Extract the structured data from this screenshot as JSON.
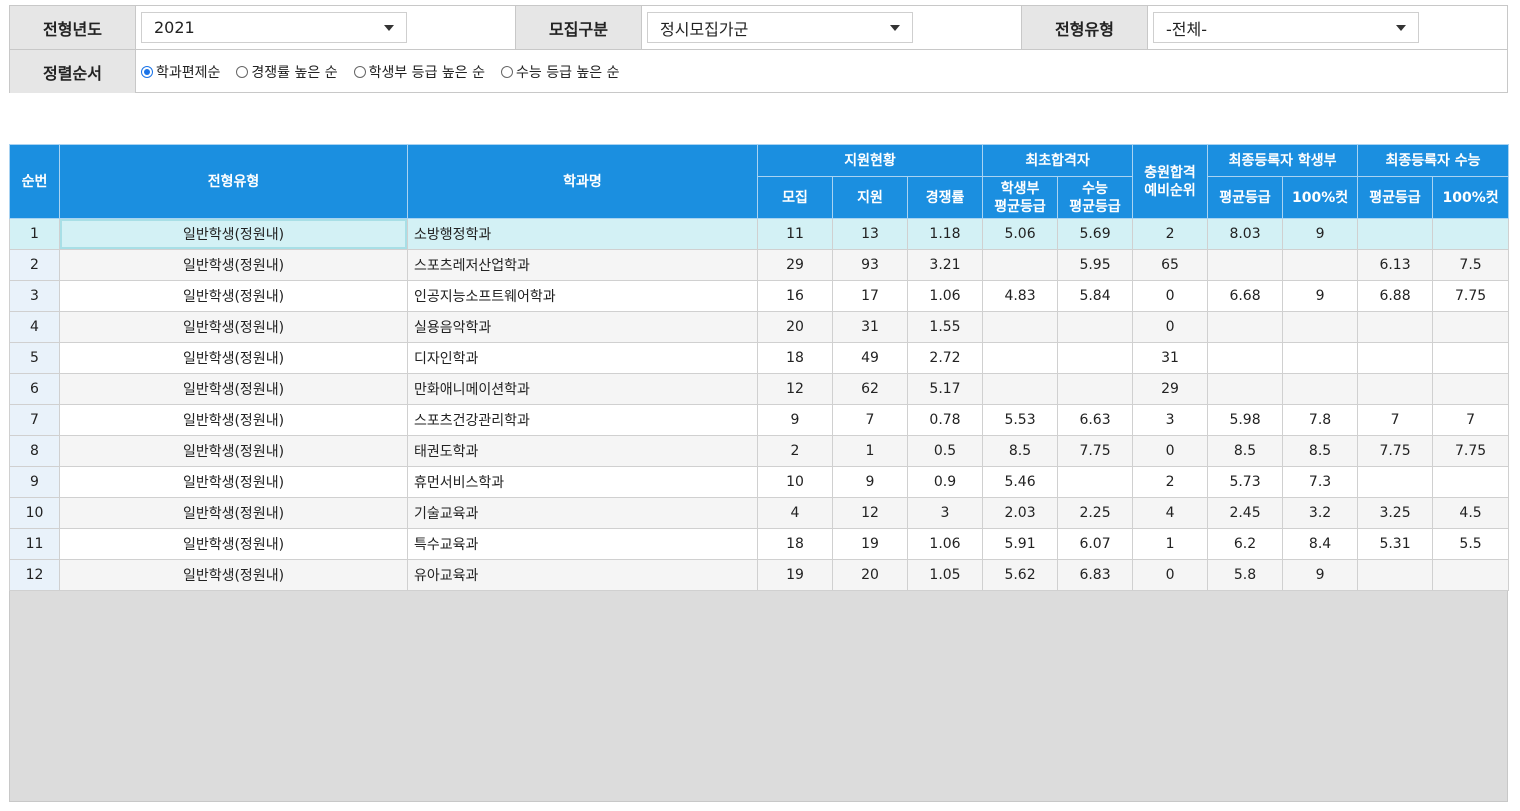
{
  "filters": {
    "year_label": "전형년도",
    "year_value": "2021",
    "recruit_label": "모집구분",
    "recruit_value": "정시모집가군",
    "type_label": "전형유형",
    "type_value": "-전체-",
    "sort_label": "정렬순서",
    "sort_options": [
      {
        "label": "학과편제순",
        "selected": true
      },
      {
        "label": "경쟁률 높은 순",
        "selected": false
      },
      {
        "label": "학생부 등급 높은 순",
        "selected": false
      },
      {
        "label": "수능 등급 높은 순",
        "selected": false
      }
    ]
  },
  "table": {
    "headers": {
      "no": "순번",
      "type": "전형유형",
      "dept": "학과명",
      "apply_group": "지원현황",
      "recruit": "모집",
      "apply": "지원",
      "ratio": "경쟁률",
      "first_group": "최초합격자",
      "first_hs": "학생부 평균등급",
      "first_csat": "수능 평균등급",
      "waitlist": "충원합격 예비순위",
      "final_hs_group": "최종등록자 학생부",
      "final_hs_avg": "평균등급",
      "final_hs_cut": "100%컷",
      "final_csat_group": "최종등록자 수능",
      "final_csat_avg": "평균등급",
      "final_csat_cut": "100%컷"
    },
    "rows": [
      {
        "no": "1",
        "type": "일반학생(정원내)",
        "dept": "소방행정학과",
        "recruit": "11",
        "apply": "13",
        "ratio": "1.18",
        "first_hs": "5.06",
        "first_csat": "5.69",
        "waitlist": "2",
        "fh_avg": "8.03",
        "fh_cut": "9",
        "fc_avg": "",
        "fc_cut": ""
      },
      {
        "no": "2",
        "type": "일반학생(정원내)",
        "dept": "스포츠레저산업학과",
        "recruit": "29",
        "apply": "93",
        "ratio": "3.21",
        "first_hs": "",
        "first_csat": "5.95",
        "waitlist": "65",
        "fh_avg": "",
        "fh_cut": "",
        "fc_avg": "6.13",
        "fc_cut": "7.5"
      },
      {
        "no": "3",
        "type": "일반학생(정원내)",
        "dept": "인공지능소프트웨어학과",
        "recruit": "16",
        "apply": "17",
        "ratio": "1.06",
        "first_hs": "4.83",
        "first_csat": "5.84",
        "waitlist": "0",
        "fh_avg": "6.68",
        "fh_cut": "9",
        "fc_avg": "6.88",
        "fc_cut": "7.75"
      },
      {
        "no": "4",
        "type": "일반학생(정원내)",
        "dept": "실용음악학과",
        "recruit": "20",
        "apply": "31",
        "ratio": "1.55",
        "first_hs": "",
        "first_csat": "",
        "waitlist": "0",
        "fh_avg": "",
        "fh_cut": "",
        "fc_avg": "",
        "fc_cut": ""
      },
      {
        "no": "5",
        "type": "일반학생(정원내)",
        "dept": "디자인학과",
        "recruit": "18",
        "apply": "49",
        "ratio": "2.72",
        "first_hs": "",
        "first_csat": "",
        "waitlist": "31",
        "fh_avg": "",
        "fh_cut": "",
        "fc_avg": "",
        "fc_cut": ""
      },
      {
        "no": "6",
        "type": "일반학생(정원내)",
        "dept": "만화애니메이션학과",
        "recruit": "12",
        "apply": "62",
        "ratio": "5.17",
        "first_hs": "",
        "first_csat": "",
        "waitlist": "29",
        "fh_avg": "",
        "fh_cut": "",
        "fc_avg": "",
        "fc_cut": ""
      },
      {
        "no": "7",
        "type": "일반학생(정원내)",
        "dept": "스포츠건강관리학과",
        "recruit": "9",
        "apply": "7",
        "ratio": "0.78",
        "first_hs": "5.53",
        "first_csat": "6.63",
        "waitlist": "3",
        "fh_avg": "5.98",
        "fh_cut": "7.8",
        "fc_avg": "7",
        "fc_cut": "7"
      },
      {
        "no": "8",
        "type": "일반학생(정원내)",
        "dept": "태권도학과",
        "recruit": "2",
        "apply": "1",
        "ratio": "0.5",
        "first_hs": "8.5",
        "first_csat": "7.75",
        "waitlist": "0",
        "fh_avg": "8.5",
        "fh_cut": "8.5",
        "fc_avg": "7.75",
        "fc_cut": "7.75"
      },
      {
        "no": "9",
        "type": "일반학생(정원내)",
        "dept": "휴먼서비스학과",
        "recruit": "10",
        "apply": "9",
        "ratio": "0.9",
        "first_hs": "5.46",
        "first_csat": "",
        "waitlist": "2",
        "fh_avg": "5.73",
        "fh_cut": "7.3",
        "fc_avg": "",
        "fc_cut": ""
      },
      {
        "no": "10",
        "type": "일반학생(정원내)",
        "dept": "기술교육과",
        "recruit": "4",
        "apply": "12",
        "ratio": "3",
        "first_hs": "2.03",
        "first_csat": "2.25",
        "waitlist": "4",
        "fh_avg": "2.45",
        "fh_cut": "3.2",
        "fc_avg": "3.25",
        "fc_cut": "4.5"
      },
      {
        "no": "11",
        "type": "일반학생(정원내)",
        "dept": "특수교육과",
        "recruit": "18",
        "apply": "19",
        "ratio": "1.06",
        "first_hs": "5.91",
        "first_csat": "6.07",
        "waitlist": "1",
        "fh_avg": "6.2",
        "fh_cut": "8.4",
        "fc_avg": "5.31",
        "fc_cut": "5.5"
      },
      {
        "no": "12",
        "type": "일반학생(정원내)",
        "dept": "유아교육과",
        "recruit": "19",
        "apply": "20",
        "ratio": "1.05",
        "first_hs": "5.62",
        "first_csat": "6.83",
        "waitlist": "0",
        "fh_avg": "5.8",
        "fh_cut": "9",
        "fc_avg": "",
        "fc_cut": ""
      }
    ]
  }
}
